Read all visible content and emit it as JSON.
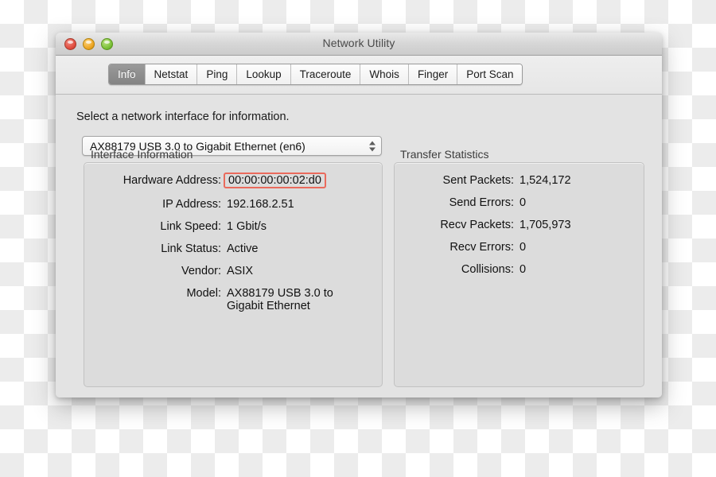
{
  "window": {
    "title": "Network Utility",
    "traffic_lights": [
      "close-button",
      "minimize-button",
      "zoom-button"
    ]
  },
  "tabs": [
    {
      "label": "Info",
      "selected": true
    },
    {
      "label": "Netstat",
      "selected": false
    },
    {
      "label": "Ping",
      "selected": false
    },
    {
      "label": "Lookup",
      "selected": false
    },
    {
      "label": "Traceroute",
      "selected": false
    },
    {
      "label": "Whois",
      "selected": false
    },
    {
      "label": "Finger",
      "selected": false
    },
    {
      "label": "Port Scan",
      "selected": false
    }
  ],
  "main": {
    "instruction": "Select a network interface for information.",
    "interface_popup": {
      "selected": "AX88179 USB 3.0 to Gigabit Ethernet (en6)"
    },
    "interface_information": {
      "title": "Interface Information",
      "rows": [
        {
          "label": "Hardware Address:",
          "value": "00:00:00:00:02:d0",
          "highlighted": true
        },
        {
          "label": "IP Address:",
          "value": "192.168.2.51",
          "highlighted": false
        },
        {
          "label": "Link Speed:",
          "value": "1 Gbit/s",
          "highlighted": false
        },
        {
          "label": "Link Status:",
          "value": "Active",
          "highlighted": false
        },
        {
          "label": "Vendor:",
          "value": "ASIX",
          "highlighted": false
        },
        {
          "label": "Model:",
          "value": "AX88179 USB 3.0 to\nGigabit Ethernet",
          "highlighted": false
        }
      ]
    },
    "transfer_statistics": {
      "title": "Transfer Statistics",
      "rows": [
        {
          "label": "Sent Packets:",
          "value": "1,524,172"
        },
        {
          "label": "Send Errors:",
          "value": "0"
        },
        {
          "label": "Recv Packets:",
          "value": "1,705,973"
        },
        {
          "label": "Recv Errors:",
          "value": "0"
        },
        {
          "label": "Collisions:",
          "value": "0"
        }
      ]
    }
  },
  "colors": {
    "window_body": "#e3e3e3",
    "groupbox_fill": "#dcdcdc",
    "tab_selected": "#8a8a8a",
    "highlight_border": "#ea6a5c"
  }
}
